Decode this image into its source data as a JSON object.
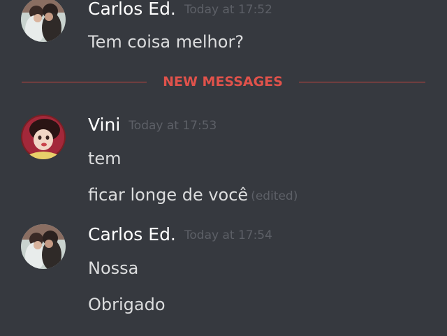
{
  "messages": [
    {
      "author": "Carlos Ed.",
      "timestamp": "Today at 17:52",
      "avatar": "carlos-avatar",
      "lines": [
        "Tem coisa melhor?"
      ]
    },
    {
      "author": "Vini",
      "timestamp": "Today at 17:53",
      "avatar": "vini-avatar",
      "lines": [
        "tem",
        "ficar longe de você"
      ],
      "edited_label": "(edited)"
    },
    {
      "author": "Carlos Ed.",
      "timestamp": "Today at 17:54",
      "avatar": "carlos-avatar",
      "lines": [
        "Nossa",
        "Obrigado"
      ]
    }
  ],
  "divider": {
    "label": "NEW MESSAGES",
    "color": "#e0524b"
  },
  "colors": {
    "background": "#36393f",
    "author": "#ffffff",
    "text": "#dcddde",
    "timestamp": "#5d6067"
  }
}
